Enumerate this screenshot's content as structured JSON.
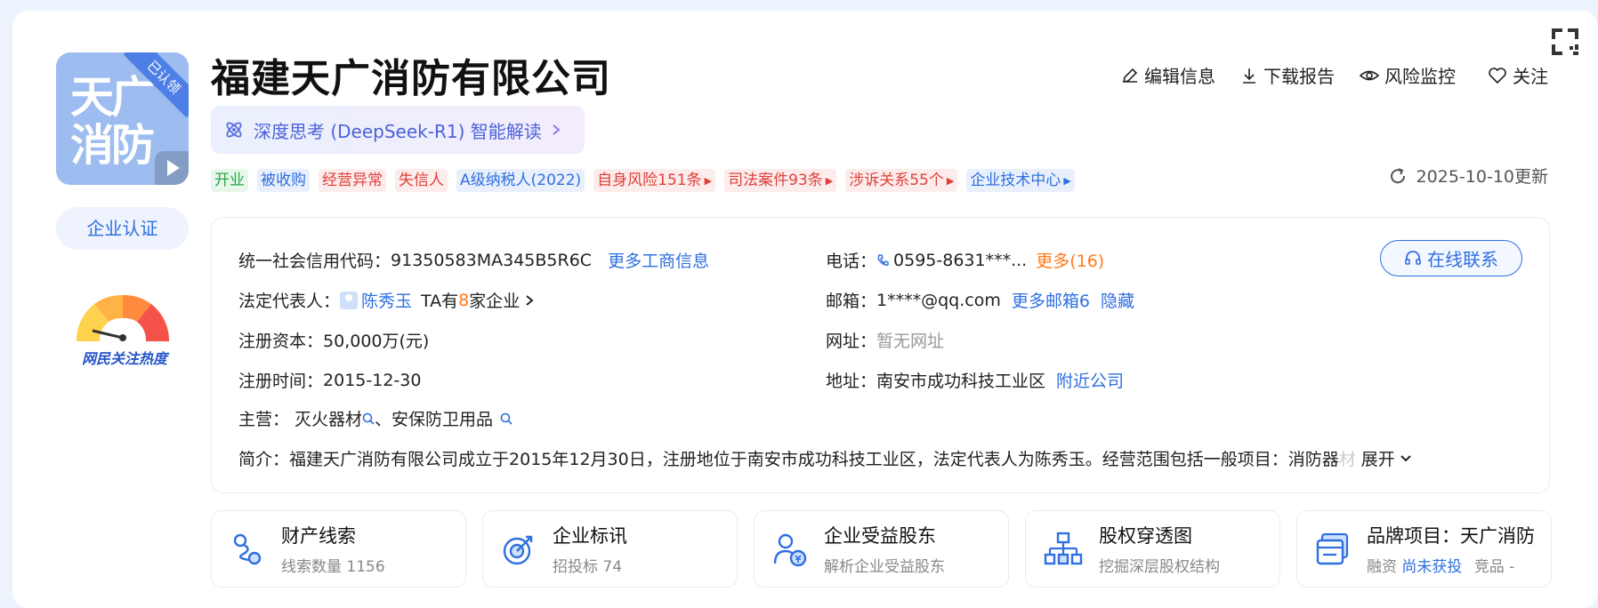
{
  "company": {
    "name": "福建天广消防有限公司",
    "logo_text": "天广消防",
    "logo_badge": "已认领",
    "cert_label": "企业认证",
    "heat_label": "网民关注热度"
  },
  "ai_bar": {
    "label": "深度思考 (DeepSeek-R1) 智能解读"
  },
  "tags": [
    {
      "label": "开业",
      "tone": "green"
    },
    {
      "label": "被收购",
      "tone": "blue"
    },
    {
      "label": "经营异常",
      "tone": "red"
    },
    {
      "label": "失信人",
      "tone": "red"
    },
    {
      "label": "A级纳税人(2022)",
      "tone": "blue"
    },
    {
      "label": "自身风险151条",
      "tone": "red"
    },
    {
      "label": "司法案件93条",
      "tone": "red"
    },
    {
      "label": "涉诉关系55个",
      "tone": "red"
    },
    {
      "label": "企业技术中心",
      "tone": "blue"
    }
  ],
  "actions": {
    "edit": "编辑信息",
    "download": "下载报告",
    "monitor": "风险监控",
    "follow": "关注"
  },
  "updated": "2025-10-10更新",
  "info": {
    "credit_code_label": "统一社会信用代码：",
    "credit_code": "91350583MA345B5R6C",
    "more_business": "更多工商信息",
    "legal_rep_label": "法定代表人：",
    "legal_rep": "陈秀玉",
    "ta_prefix": "TA有",
    "ta_count": "8",
    "ta_suffix": "家企业",
    "capital_label": "注册资本：",
    "capital": "50,000万(元)",
    "reg_date_label": "注册时间：",
    "reg_date": "2015-12-30",
    "main_label": "主营：",
    "main_item_1": "灭火器材",
    "main_sep": "、",
    "main_item_2": "安保防卫用品",
    "phone_label": "电话：",
    "phone": "0595-8631***...",
    "phone_more": "更多(16)",
    "email_label": "邮箱：",
    "email": "1****@qq.com",
    "email_more": "更多邮箱6",
    "email_hide": "隐藏",
    "website_label": "网址：",
    "website": "暂无网址",
    "address_label": "地址：",
    "address": "南安市成功科技工业区",
    "nearby": "附近公司",
    "intro_label": "简介：",
    "intro": "福建天广消防有限公司成立于2015年12月30日，注册地位于南安市成功科技工业区，法定代表人为陈秀玉。经营范围包括一般项目：消防器",
    "intro_fade": "材",
    "expand": "展开",
    "contact_btn": "在线联系"
  },
  "features": [
    {
      "title": "财产线索",
      "sub": "线索数量 1156",
      "icon": "property-clue-icon"
    },
    {
      "title": "企业标讯",
      "sub": "招投标 74",
      "icon": "bid-target-icon"
    },
    {
      "title": "企业受益股东",
      "sub": "解析企业受益股东",
      "icon": "beneficiary-icon"
    },
    {
      "title": "股权穿透图",
      "sub": "挖掘深层股权结构",
      "icon": "equity-tree-icon"
    },
    {
      "title": "品牌项目：天广消防",
      "sub_prefix": "融资",
      "sub_link": "尚未获投",
      "sub_suffix": "竞品 -",
      "icon": "brand-project-icon"
    }
  ],
  "colors": {
    "accent": "#2f6fe0",
    "red": "#e0403a",
    "green": "#27a845",
    "orange": "#ff7a1a"
  }
}
